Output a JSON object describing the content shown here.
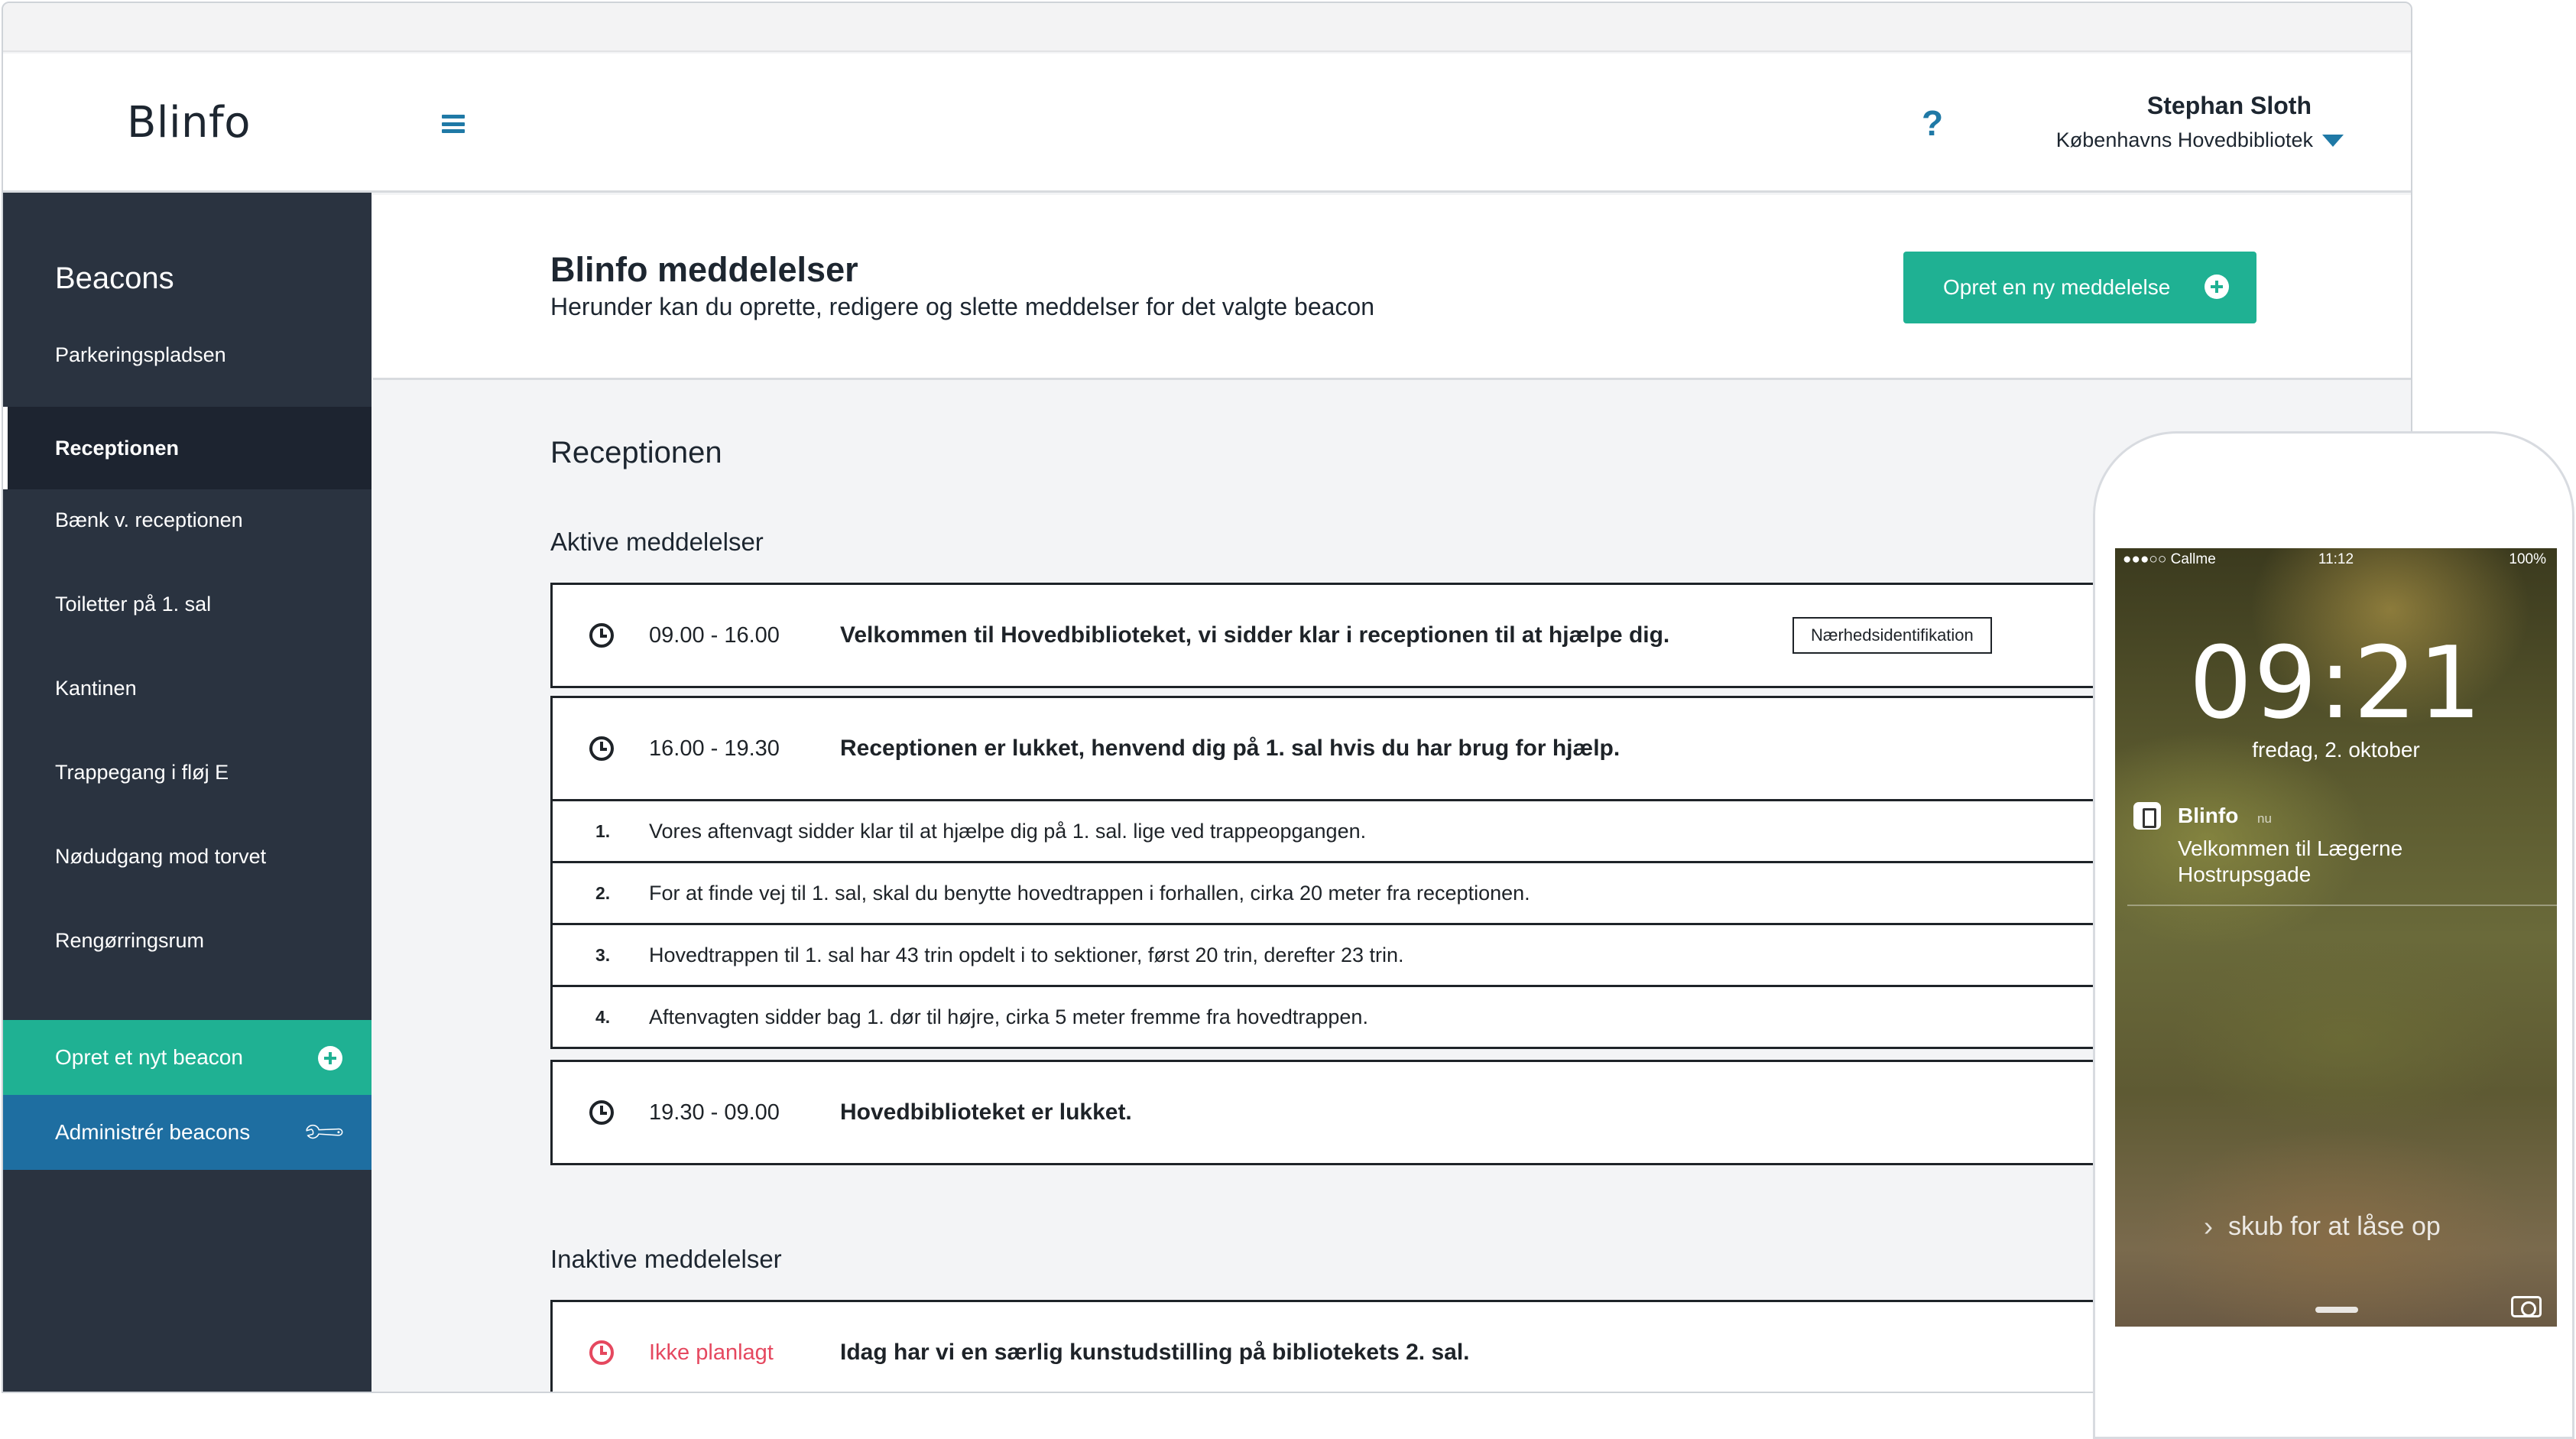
{
  "app": {
    "logo": "Blinfo"
  },
  "header": {
    "help_glyph": "?",
    "user_name": "Stephan Sloth",
    "user_library": "Københavns Hovedbibliotek"
  },
  "sidebar": {
    "title": "Beacons",
    "items": [
      {
        "label": "Parkeringspladsen",
        "active": false
      },
      {
        "label": "Receptionen",
        "active": true
      },
      {
        "label": "Bænk v. receptionen",
        "active": false
      },
      {
        "label": "Toiletter på 1. sal",
        "active": false
      },
      {
        "label": "Kantinen",
        "active": false
      },
      {
        "label": "Trappegang i fløj E",
        "active": false
      },
      {
        "label": "Nødudgang mod torvet",
        "active": false
      },
      {
        "label": "Rengørringsrum",
        "active": false
      }
    ],
    "create_label": "Opret et nyt beacon",
    "admin_label": "Administrér beacons"
  },
  "page": {
    "title": "Blinfo meddelelser",
    "subtitle": "Herunder kan du oprette, redigere og slette meddelser for det valgte beacon",
    "new_button": "Opret en ny meddelelse"
  },
  "main": {
    "section_title": "Receptionen",
    "active_title": "Aktive meddelelser",
    "inactive_title": "Inaktive meddelelser",
    "active_messages": [
      {
        "time": "09.00 - 16.00",
        "text": "Velkommen til Hovedbiblioteket, vi sidder klar i receptionen til at hjælpe dig.",
        "tag": "Nærhedsidentifikation"
      },
      {
        "time": "16.00 - 19.30",
        "text": "Receptionen er lukket, henvend dig på 1. sal hvis du har brug for hjælp."
      },
      {
        "time": "19.30 - 09.00",
        "text": "Hovedbiblioteket er lukket."
      }
    ],
    "steps": [
      {
        "num": "1.",
        "text": "Vores aftenvagt sidder klar til at hjælpe dig på 1. sal. lige ved trappeopgangen."
      },
      {
        "num": "2.",
        "text": "For at finde vej til 1. sal, skal du benytte hovedtrappen i forhallen, cirka 20 meter fra receptionen."
      },
      {
        "num": "3.",
        "text": "Hovedtrappen til 1. sal har 43 trin opdelt i to sektioner, først 20 trin, derefter 23 trin."
      },
      {
        "num": "4.",
        "text": "Aftenvagten sidder bag 1. dør til højre, cirka 5 meter fremme fra hovedtrappen."
      }
    ],
    "inactive_messages": [
      {
        "time": "Ikke planlagt",
        "text": "Idag har vi en særlig kunstudstilling på bibliotekets 2. sal."
      }
    ]
  },
  "phone": {
    "carrier": "●●●○○ Callme",
    "status_time": "11:12",
    "battery": "100%",
    "clock": "09:21",
    "date": "fredag, 2. oktober",
    "notification": {
      "app": "Blinfo",
      "age": "nu",
      "body": "Velkommen til Lægerne Hostrupsgade"
    },
    "unlock_chevron": "›",
    "unlock_text": "skub for at låse op"
  },
  "colors": {
    "sidebar_bg": "#2a3340",
    "accent_green": "#1fb193",
    "accent_blue": "#1e6ea1",
    "icon_blue": "#1f79a6",
    "inactive_red": "#e5485f"
  }
}
